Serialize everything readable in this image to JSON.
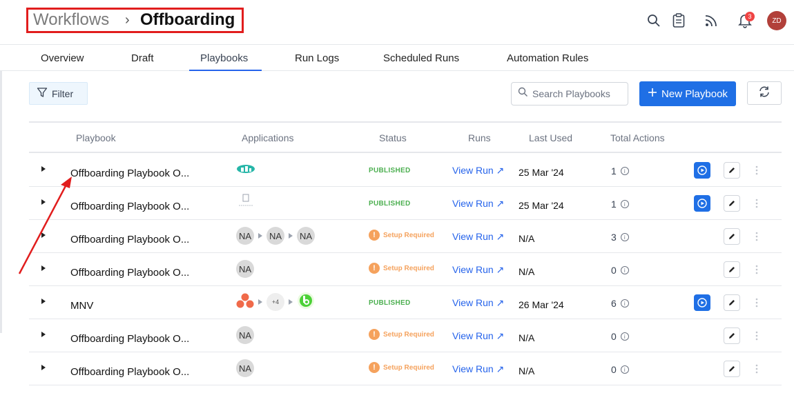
{
  "header": {
    "breadcrumb_root": "Workflows",
    "breadcrumb_separator": "›",
    "breadcrumb_current": "Offboarding",
    "notification_count": "3",
    "avatar_initials": "ZD"
  },
  "tabs": [
    {
      "label": "Overview"
    },
    {
      "label": "Draft"
    },
    {
      "label": "Playbooks"
    },
    {
      "label": "Run Logs"
    },
    {
      "label": "Scheduled Runs"
    },
    {
      "label": "Automation Rules"
    }
  ],
  "active_tab": "Playbooks",
  "toolbar": {
    "filter_label": "Filter",
    "search_placeholder": "Search Playbooks",
    "new_button_label": "New Playbook"
  },
  "table": {
    "columns": [
      "Playbook",
      "Applications",
      "Status",
      "Runs",
      "Last Used",
      "Total Actions"
    ],
    "rows": [
      {
        "name": "Offboarding Playbook O...",
        "apps": [
          "teal-logo-icon"
        ],
        "status": "PUBLISHED",
        "runs": "View Run ↗",
        "last_used": "25 Mar '24",
        "total": "1",
        "runnable": true
      },
      {
        "name": "Offboarding Playbook O...",
        "apps": [
          "gray-app-icon"
        ],
        "status": "PUBLISHED",
        "runs": "View Run ↗",
        "last_used": "25 Mar '24",
        "total": "1",
        "runnable": true
      },
      {
        "name": "Offboarding Playbook O...",
        "apps": [
          "NA",
          "NA",
          "NA"
        ],
        "status": "Setup Required",
        "runs": "View Run ↗",
        "last_used": "N/A",
        "total": "3",
        "runnable": false
      },
      {
        "name": "Offboarding Playbook O...",
        "apps": [
          "NA"
        ],
        "status": "Setup Required",
        "runs": "View Run ↗",
        "last_used": "N/A",
        "total": "0",
        "runnable": false
      },
      {
        "name": "MNV",
        "apps": [
          "asana-icon",
          "+4",
          "green-app-icon"
        ],
        "status": "PUBLISHED",
        "runs": "View Run ↗",
        "last_used": "26 Mar '24",
        "total": "6",
        "runnable": true
      },
      {
        "name": "Offboarding Playbook O...",
        "apps": [
          "NA"
        ],
        "status": "Setup Required",
        "runs": "View Run ↗",
        "last_used": "N/A",
        "total": "0",
        "runnable": false
      },
      {
        "name": "Offboarding Playbook O...",
        "apps": [
          "NA"
        ],
        "status": "Setup Required",
        "runs": "View Run ↗",
        "last_used": "N/A",
        "total": "0",
        "runnable": false
      }
    ]
  },
  "colors": {
    "accent": "#1f6fe5",
    "published": "#4caf50",
    "setup": "#f5a25d",
    "annotation": "#e11d1d"
  }
}
